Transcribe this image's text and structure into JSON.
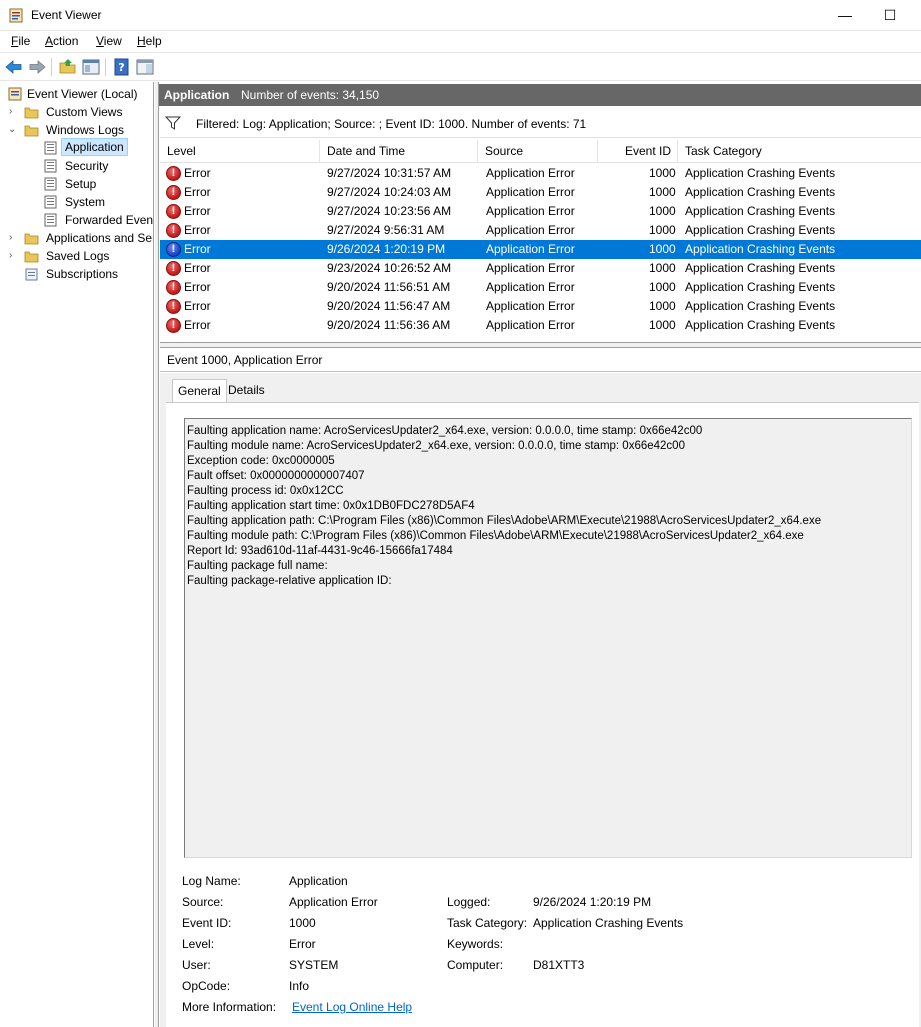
{
  "window": {
    "title": "Event Viewer",
    "minimize_glyph": "—",
    "maximize_glyph": "☐"
  },
  "menu": [
    {
      "accel": "F",
      "rest": "ile"
    },
    {
      "accel": "A",
      "rest": "ction"
    },
    {
      "accel": "V",
      "rest": "iew"
    },
    {
      "accel": "H",
      "rest": "elp"
    }
  ],
  "toolbar": {
    "icons": [
      "back-arrow-icon",
      "forward-arrow-icon",
      "open-folder-icon",
      "show-hide-tree-icon",
      "help-icon",
      "action-pane-icon"
    ]
  },
  "tree": {
    "root": "Event Viewer (Local)",
    "custom_views": "Custom Views",
    "windows_logs": "Windows Logs",
    "application": "Application",
    "security": "Security",
    "setup": "Setup",
    "system": "System",
    "forwarded": "Forwarded Events",
    "apps_services": "Applications and Services Logs",
    "saved_logs": "Saved Logs",
    "subscriptions": "Subscriptions"
  },
  "pane": {
    "name": "Application",
    "count": "Number of events: 34,150",
    "filter": "Filtered: Log: Application; Source: ; Event ID: 1000. Number of events: 71"
  },
  "grid": {
    "headers": {
      "level": "Level",
      "datetime": "Date and Time",
      "source": "Source",
      "eventid": "Event ID",
      "category": "Task Category"
    },
    "rows": [
      {
        "level": "Error",
        "datetime": "9/27/2024 10:31:57 AM",
        "source": "Application Error",
        "eventid": "1000",
        "category": "Application Crashing Events"
      },
      {
        "level": "Error",
        "datetime": "9/27/2024 10:24:03 AM",
        "source": "Application Error",
        "eventid": "1000",
        "category": "Application Crashing Events"
      },
      {
        "level": "Error",
        "datetime": "9/27/2024 10:23:56 AM",
        "source": "Application Error",
        "eventid": "1000",
        "category": "Application Crashing Events"
      },
      {
        "level": "Error",
        "datetime": "9/27/2024 9:56:31 AM",
        "source": "Application Error",
        "eventid": "1000",
        "category": "Application Crashing Events"
      },
      {
        "level": "Error",
        "datetime": "9/26/2024 1:20:19 PM",
        "source": "Application Error",
        "eventid": "1000",
        "category": "Application Crashing Events"
      },
      {
        "level": "Error",
        "datetime": "9/23/2024 10:26:52 AM",
        "source": "Application Error",
        "eventid": "1000",
        "category": "Application Crashing Events"
      },
      {
        "level": "Error",
        "datetime": "9/20/2024 11:56:51 AM",
        "source": "Application Error",
        "eventid": "1000",
        "category": "Application Crashing Events"
      },
      {
        "level": "Error",
        "datetime": "9/20/2024 11:56:47 AM",
        "source": "Application Error",
        "eventid": "1000",
        "category": "Application Crashing Events"
      },
      {
        "level": "Error",
        "datetime": "9/20/2024 11:56:36 AM",
        "source": "Application Error",
        "eventid": "1000",
        "category": "Application Crashing Events"
      }
    ],
    "selected_row": 4
  },
  "details": {
    "header": "Event 1000, Application Error",
    "tabs": {
      "general": "General",
      "details": "Details"
    },
    "description": [
      "Faulting application name: AcroServicesUpdater2_x64.exe, version: 0.0.0.0, time stamp: 0x66e42c00",
      "Faulting module name: AcroServicesUpdater2_x64.exe, version: 0.0.0.0, time stamp: 0x66e42c00",
      "Exception code: 0xc0000005",
      "Fault offset: 0x0000000000007407",
      "Faulting process id: 0x0x12CC",
      "Faulting application start time: 0x0x1DB0FDC278D5AF4",
      "Faulting application path: C:\\Program Files (x86)\\Common Files\\Adobe\\ARM\\Execute\\21988\\AcroServicesUpdater2_x64.exe",
      "Faulting module path: C:\\Program Files (x86)\\Common Files\\Adobe\\ARM\\Execute\\21988\\AcroServicesUpdater2_x64.exe",
      "Report Id: 93ad610d-11af-4431-9c46-15666fa17484",
      "Faulting package full name:",
      "Faulting package-relative application ID:"
    ],
    "props": {
      "log_name_label": "Log Name:",
      "log_name": "Application",
      "source_label": "Source:",
      "source": "Application Error",
      "logged_label": "Logged:",
      "logged": "9/26/2024 1:20:19 PM",
      "event_id_label": "Event ID:",
      "event_id": "1000",
      "task_label": "Task Category:",
      "task": "Application Crashing Events",
      "level_label": "Level:",
      "level": "Error",
      "keywords_label": "Keywords:",
      "keywords": "",
      "user_label": "User:",
      "user": "SYSTEM",
      "computer_label": "Computer:",
      "computer": "D81XTT3",
      "opcode_label": "OpCode:",
      "opcode": "Info",
      "more_info_label": "More Information:",
      "more_info_link": "Event Log Online Help"
    }
  },
  "colors": {
    "selection": "#0078d7",
    "pane_header": "#676767",
    "link": "#0066cc"
  }
}
